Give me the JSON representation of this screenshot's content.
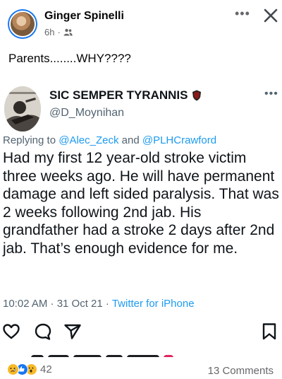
{
  "post": {
    "author": "Ginger Spinelli",
    "time": "6h",
    "meta_separator": "·",
    "audience_icon": "friends-icon",
    "text": "Parents........WHY????",
    "more_icon": "more-horizontal-icon",
    "more_glyph": "•••",
    "close_icon": "close-icon"
  },
  "tweet": {
    "display_name": "SIC SEMPER TYRANNIS",
    "name_badge_icon": "shield-icon",
    "handle": "@D_Moynihan",
    "more_glyph": "•••",
    "replying_prefix": "Replying to ",
    "replying_mention_1": "@Alec_Zeck",
    "replying_and": " and ",
    "replying_mention_2": "@PLHCrawford",
    "body": "Had my first 12 year-old stroke victim three weeks ago.  He will have permanent damage and left sided paralysis. That was 2 weeks following 2nd jab. His grandfather had a stroke 2 days after 2nd jab. That’s enough evidence for me.",
    "timestamp": "10:02 AM · 31 Oct 21 · ",
    "source": "Twitter for iPhone",
    "actions": [
      "heart-icon",
      "comment-icon",
      "share-icon",
      "bookmark-icon"
    ]
  },
  "footer": {
    "reactions": [
      "sad-emoji",
      "like-emoji",
      "wow-emoji"
    ],
    "reaction_count": "42",
    "comments": "13 Comments"
  },
  "colors": {
    "facebook_blue": "#1877f2",
    "twitter_blue": "#1d9bf0",
    "secondary_text": "#65676b",
    "tweet_secondary": "#536471",
    "badge_red": "#8b1a1a"
  }
}
